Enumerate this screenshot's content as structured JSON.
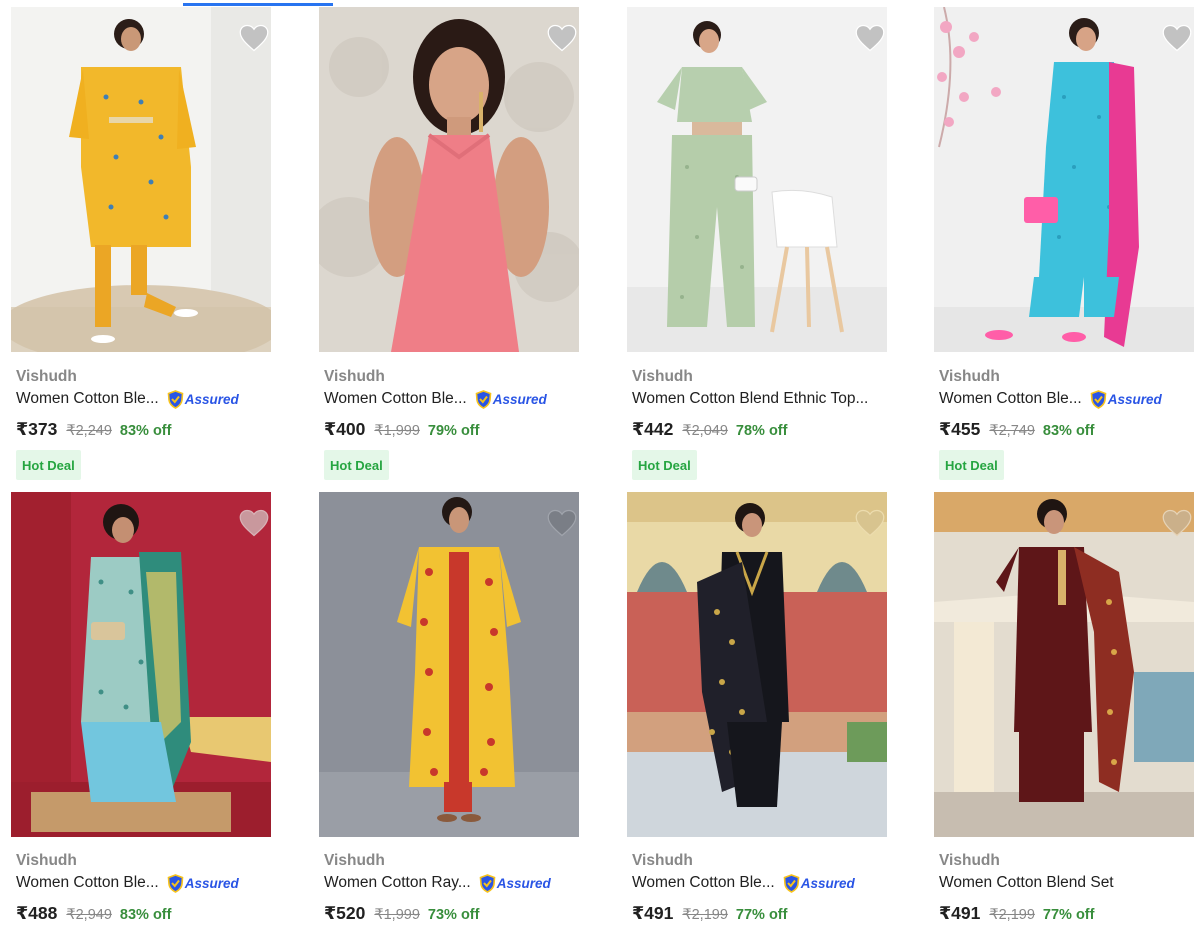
{
  "colors": {
    "accent": "#2874f0",
    "brand_grey": "#878787",
    "discount_green": "#388e3c",
    "hot_deal_bg": "#e4f7e8",
    "hot_deal_text": "#26a541",
    "assured_blue": "#2a55e5",
    "wishlist_grey": "#c2c2c2"
  },
  "products": [
    {
      "brand": "Vishudh",
      "title": "Women Cotton Ble...",
      "assured": true,
      "assured_label": "Assured",
      "price": "₹373",
      "mrp": "₹2,249",
      "discount": "83% off",
      "deal": "Hot Deal",
      "image": "yellow-kaftan-kurta-set",
      "wishlist_icon": "heart-icon"
    },
    {
      "brand": "Vishudh",
      "title": "Women Cotton Ble...",
      "assured": true,
      "assured_label": "Assured",
      "price": "₹400",
      "mrp": "₹1,999",
      "discount": "79% off",
      "deal": "Hot Deal",
      "image": "pink-halter-top",
      "wishlist_icon": "heart-icon"
    },
    {
      "brand": "Vishudh",
      "title": "Women Cotton Blend Ethnic Top...",
      "assured": false,
      "price": "₹442",
      "mrp": "₹2,049",
      "discount": "78% off",
      "deal": "Hot Deal",
      "image": "sage-green-coord-set",
      "wishlist_icon": "heart-icon"
    },
    {
      "brand": "Vishudh",
      "title": "Women Cotton Ble...",
      "assured": true,
      "assured_label": "Assured",
      "price": "₹455",
      "mrp": "₹2,749",
      "discount": "83% off",
      "deal": "Hot Deal",
      "image": "aqua-kurta-pink-dupatta",
      "wishlist_icon": "heart-icon"
    },
    {
      "brand": "Vishudh",
      "title": "Women Cotton Ble...",
      "assured": true,
      "assured_label": "Assured",
      "price": "₹488",
      "mrp": "₹2,949",
      "discount": "83% off",
      "image": "sea-green-printed-suit",
      "wishlist_icon": "heart-icon"
    },
    {
      "brand": "Vishudh",
      "title": "Women Cotton Ray...",
      "assured": true,
      "assured_label": "Assured",
      "price": "₹520",
      "mrp": "₹1,999",
      "discount": "73% off",
      "image": "mustard-floral-jacket-kurta",
      "wishlist_icon": "heart-icon"
    },
    {
      "brand": "Vishudh",
      "title": "Women Cotton Ble...",
      "assured": true,
      "assured_label": "Assured",
      "price": "₹491",
      "mrp": "₹2,199",
      "discount": "77% off",
      "image": "black-kurta-gold-dupatta",
      "wishlist_icon": "heart-icon"
    },
    {
      "brand": "Vishudh",
      "title": "Women Cotton Blend Set",
      "assured": false,
      "price": "₹491",
      "mrp": "₹2,199",
      "discount": "77% off",
      "image": "maroon-kurta-set",
      "wishlist_icon": "heart-icon"
    }
  ]
}
